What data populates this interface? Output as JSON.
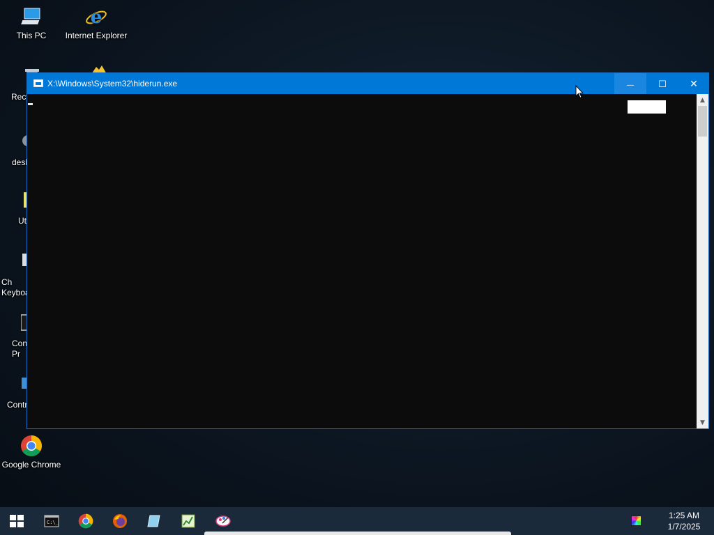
{
  "desktop": {
    "icons": [
      {
        "label": "This PC",
        "icon": "this-pc-icon"
      },
      {
        "label": "Internet Explorer",
        "icon": "internet-explorer-icon"
      },
      {
        "label": "Recy",
        "icon": "recycle-bin-icon"
      },
      {
        "label": "",
        "icon": "folder-icon"
      },
      {
        "label": "desk",
        "icon": "settings-icon"
      },
      {
        "label": "Ut",
        "icon": "utility-icon"
      },
      {
        "label": "Ch Keyboa",
        "icon": "keyboard-icon"
      },
      {
        "label": "Con Pr",
        "icon": "command-prompt-icon"
      },
      {
        "label": "Contr",
        "icon": "control-panel-icon"
      },
      {
        "label": "Google Chrome",
        "icon": "chrome-icon"
      }
    ]
  },
  "window": {
    "title": "X:\\Windows\\System32\\hiderun.exe",
    "buttons": {
      "minimize": "—",
      "maximize": "☐",
      "close": "✕"
    },
    "scroll_up": "▲",
    "scroll_down": "▼"
  },
  "taskbar": {
    "items": [
      {
        "name": "start",
        "icon": "windows-start-icon"
      },
      {
        "name": "command prompt",
        "icon": "cmd-icon"
      },
      {
        "name": "chrome",
        "icon": "chrome-icon"
      },
      {
        "name": "firefox",
        "icon": "firefox-icon"
      },
      {
        "name": "notes",
        "icon": "notepad-icon"
      },
      {
        "name": "chart app",
        "icon": "chart-app-icon"
      },
      {
        "name": "paint",
        "icon": "paint-icon"
      }
    ],
    "clock": {
      "time": "1:25 AM",
      "date": "1/7/2025"
    }
  },
  "colors": {
    "titlebar": "#0078d7",
    "console_bg": "#0c0c0c",
    "taskbar": "#1b2a3a"
  }
}
